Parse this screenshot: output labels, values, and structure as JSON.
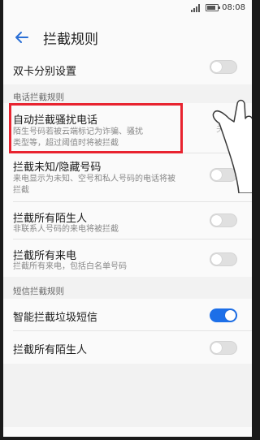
{
  "status": {
    "time": "08:08"
  },
  "appbar": {
    "title": "拦截规则"
  },
  "rows": {
    "dual_sim": {
      "title": "双卡分别设置",
      "toggle_on": false
    },
    "auto_block": {
      "title": "自动拦截骚扰电话",
      "desc1": "陌生号码若被云端标记为诈骗、骚扰",
      "desc2": "类型等，超过阈值时将被拦截",
      "value": "关闭"
    },
    "block_unknown": {
      "title": "拦截未知/隐藏号码",
      "desc1": "来电显示为未知、空号和私人号码的电话将被",
      "desc2": "拦截",
      "toggle_on": false
    },
    "block_strangers_call": {
      "title": "拦截所有陌生人",
      "desc1": "非联系人号码的来电将被拦截",
      "toggle_on": false
    },
    "block_all_calls": {
      "title": "拦截所有来电",
      "desc1": "拦截所有来电，包括白名单号码",
      "toggle_on": false
    },
    "smart_spam": {
      "title": "智能拦截垃圾短信",
      "toggle_on": true
    },
    "block_strangers_sms": {
      "title": "拦截所有陌生人",
      "toggle_on": false
    }
  },
  "sections": {
    "call_rules": "电话拦截规则",
    "sms_rules": "短信拦截规则"
  },
  "colors": {
    "accent": "#1d6fe8",
    "highlight": "#e8232f"
  },
  "icons": {
    "back": "back-arrow-icon"
  }
}
